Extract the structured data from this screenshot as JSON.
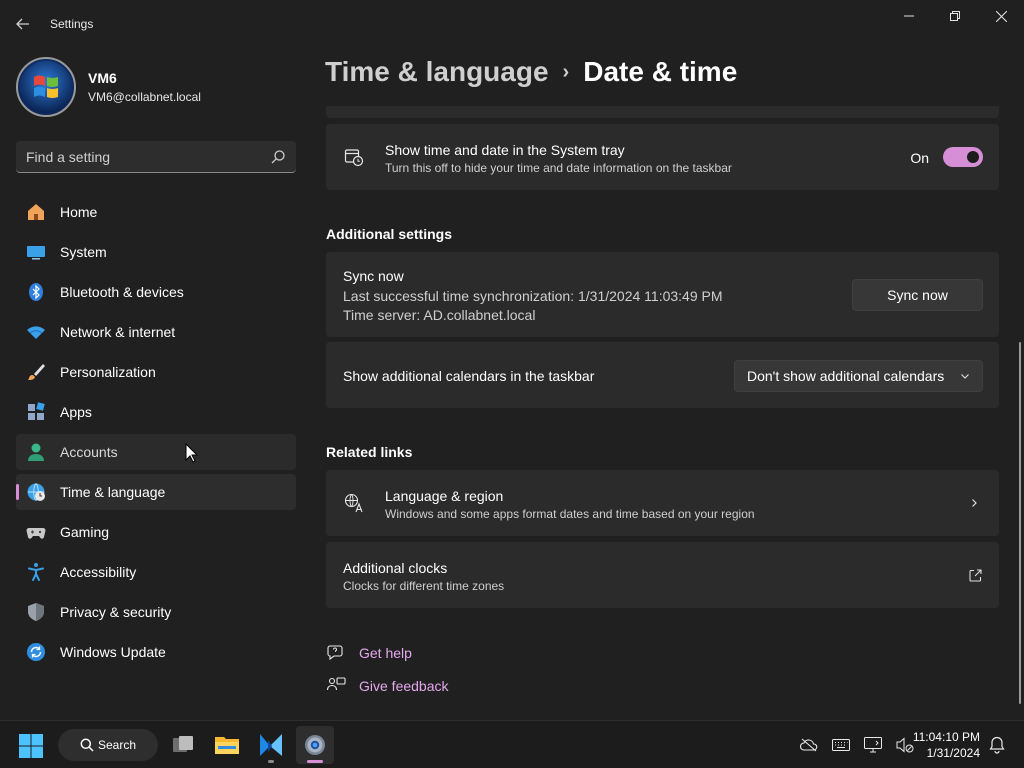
{
  "window": {
    "app_title": "Settings",
    "minimize_glyph": "—",
    "maximize_glyph": "❐",
    "close_glyph": "✕"
  },
  "profile": {
    "name": "VM6",
    "email": "VM6@collabnet.local"
  },
  "search": {
    "placeholder": "Find a setting"
  },
  "sidebar": {
    "items": [
      {
        "label": "Home",
        "icon": "home-icon"
      },
      {
        "label": "System",
        "icon": "system-icon"
      },
      {
        "label": "Bluetooth & devices",
        "icon": "bluetooth-icon"
      },
      {
        "label": "Network & internet",
        "icon": "wifi-icon"
      },
      {
        "label": "Personalization",
        "icon": "brush-icon"
      },
      {
        "label": "Apps",
        "icon": "apps-icon"
      },
      {
        "label": "Accounts",
        "icon": "person-icon"
      },
      {
        "label": "Time & language",
        "icon": "globe-clock-icon"
      },
      {
        "label": "Gaming",
        "icon": "gamepad-icon"
      },
      {
        "label": "Accessibility",
        "icon": "accessibility-icon"
      },
      {
        "label": "Privacy & security",
        "icon": "shield-icon"
      },
      {
        "label": "Windows Update",
        "icon": "update-icon"
      }
    ],
    "active_index": 7,
    "hover_index": 6
  },
  "breadcrumb": {
    "parent": "Time & language",
    "separator": "›",
    "current": "Date & time"
  },
  "tray_setting": {
    "title": "Show time and date in the System tray",
    "description": "Turn this off to hide your time and date information on the taskbar",
    "state_label": "On",
    "state": true
  },
  "additional_settings": {
    "header": "Additional settings",
    "sync": {
      "title": "Sync now",
      "last_sync": "Last successful time synchronization: 1/31/2024 11:03:49 PM",
      "server": "Time server: AD.collabnet.local",
      "button_label": "Sync now"
    },
    "calendars": {
      "title": "Show additional calendars in the taskbar",
      "selected": "Don't show additional calendars"
    }
  },
  "related_links": {
    "header": "Related links",
    "language_region": {
      "title": "Language & region",
      "description": "Windows and some apps format dates and time based on your region"
    },
    "additional_clocks": {
      "title": "Additional clocks",
      "description": "Clocks for different time zones"
    }
  },
  "help": {
    "get_help": "Get help",
    "give_feedback": "Give feedback"
  },
  "taskbar": {
    "search_label": "Search",
    "time": "11:04:10 PM",
    "date": "1/31/2024"
  },
  "colors": {
    "accent": "#d68fd6",
    "link": "#e3a8ec",
    "background": "#202020",
    "card": "#2b2b2b"
  }
}
